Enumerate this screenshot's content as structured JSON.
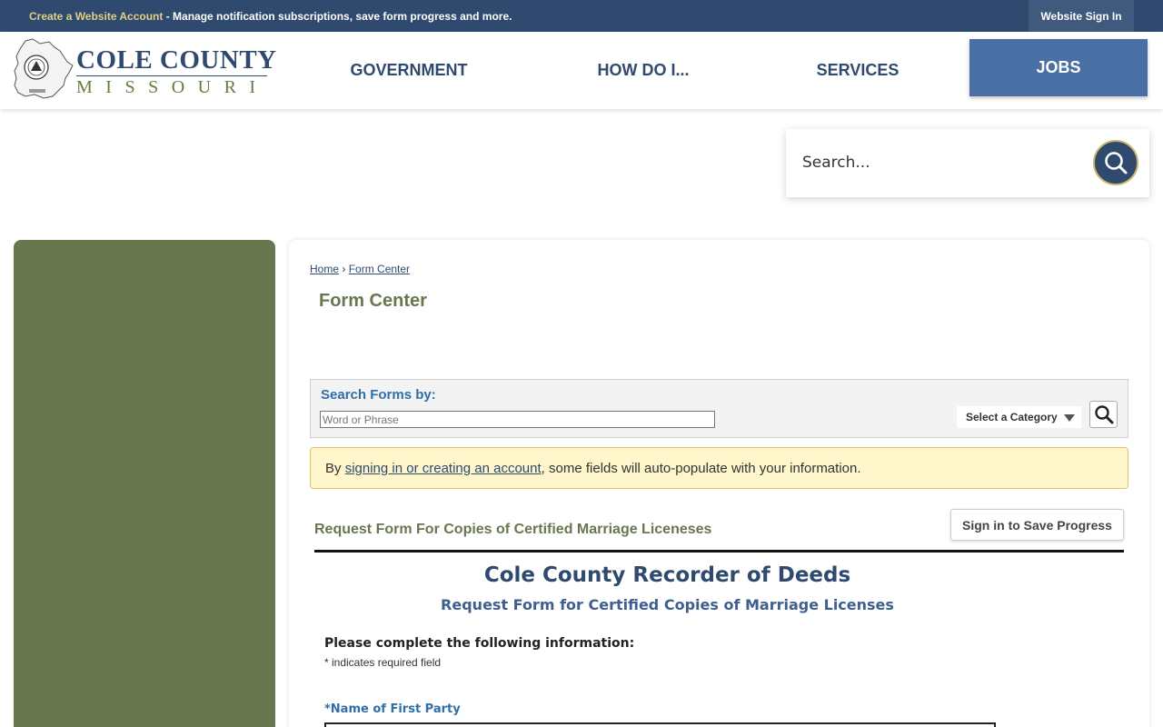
{
  "topbar": {
    "create_account_link": "Create a Website Account",
    "promo_text": " - Manage notification subscriptions, save form progress and more.",
    "signin_label": "Website Sign In"
  },
  "logo": {
    "name": "COLE COUNTY",
    "state": "MISSOURI"
  },
  "nav": {
    "items": [
      {
        "label": "GOVERNMENT"
      },
      {
        "label": "HOW DO I..."
      },
      {
        "label": "SERVICES"
      },
      {
        "label": "JOBS",
        "active": true
      }
    ]
  },
  "site_search": {
    "placeholder": "Search..."
  },
  "breadcrumb": {
    "home": "Home",
    "separator": "›",
    "current": "Form Center"
  },
  "page_title": "Form Center",
  "search_forms": {
    "label": "Search Forms by:",
    "placeholder": "Word or Phrase",
    "category_label": "Select a Category"
  },
  "notice": {
    "prefix": "By ",
    "link": "signing in or creating an account",
    "suffix": ", some fields will auto-populate with your information."
  },
  "form": {
    "name": "Request Form For Copies of Certified Marriage Liceneses",
    "save_progress_label": "Sign in to Save Progress",
    "org_title": "Cole County Recorder of Deeds",
    "org_subtitle": "Request Form for Certified Copies of Marriage Licenses",
    "instructions": "Please complete the following information:",
    "required_note": "* indicates required field",
    "fields": [
      {
        "label": "*Name of First Party",
        "value": ""
      }
    ]
  },
  "colors": {
    "navy": "#2f4a6e",
    "olive": "#69774e",
    "jobs_button": "#4a6fa5",
    "notice_bg": "#fff6cc"
  }
}
